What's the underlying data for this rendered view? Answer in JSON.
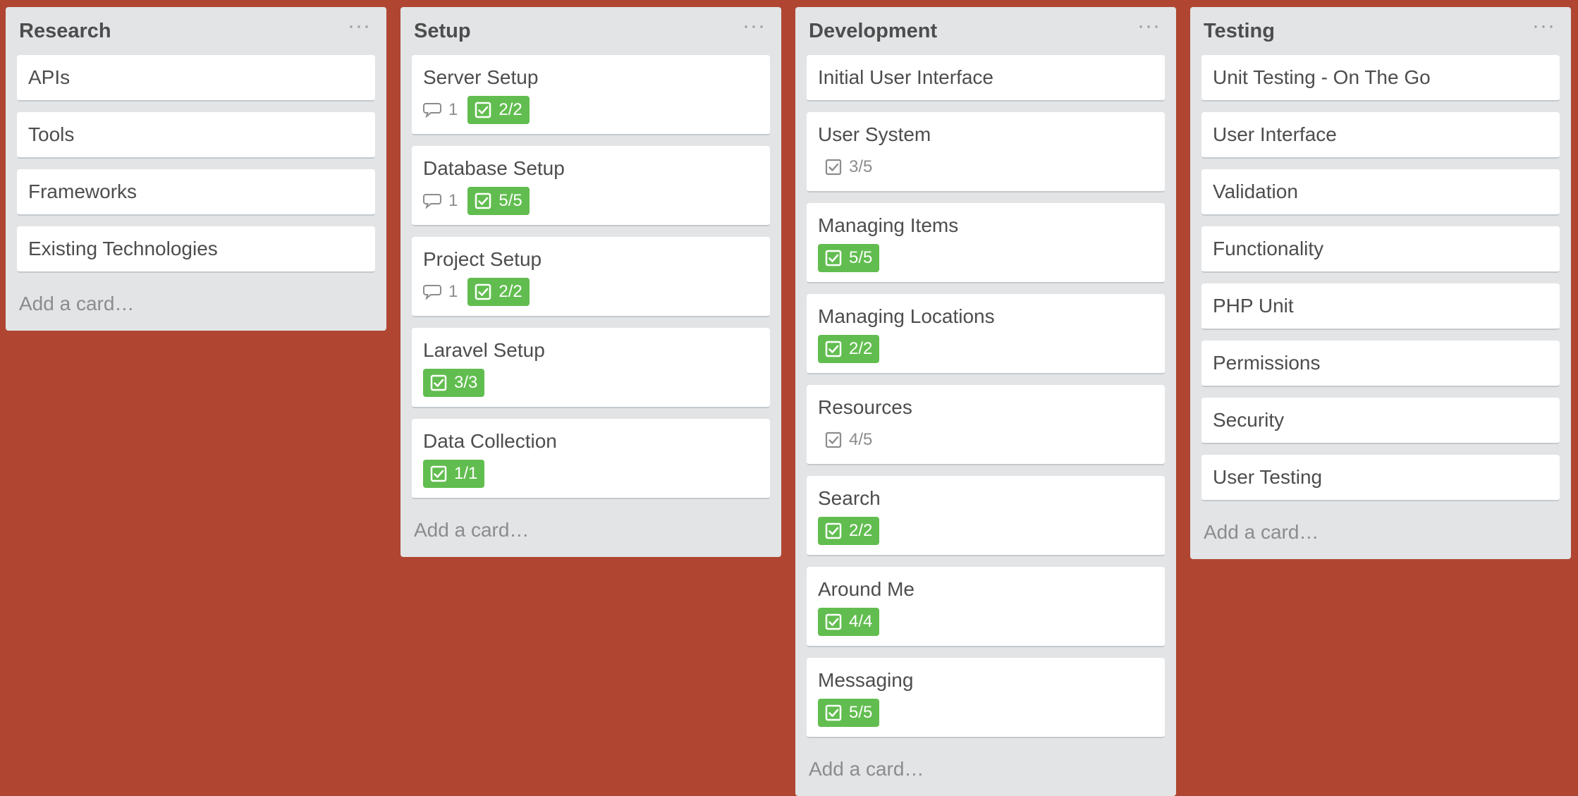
{
  "lists": [
    {
      "title": "Research",
      "menu": "···",
      "add_card": "Add a card…",
      "cards": [
        {
          "title": "APIs"
        },
        {
          "title": "Tools"
        },
        {
          "title": "Frameworks"
        },
        {
          "title": "Existing Technologies"
        }
      ]
    },
    {
      "title": "Setup",
      "menu": "···",
      "add_card": "Add a card…",
      "cards": [
        {
          "title": "Server Setup",
          "comments": "1",
          "checklist": "2/2",
          "complete": true
        },
        {
          "title": "Database Setup",
          "comments": "1",
          "checklist": "5/5",
          "complete": true
        },
        {
          "title": "Project Setup",
          "comments": "1",
          "checklist": "2/2",
          "complete": true
        },
        {
          "title": "Laravel Setup",
          "checklist": "3/3",
          "complete": true
        },
        {
          "title": "Data Collection",
          "checklist": "1/1",
          "complete": true
        }
      ]
    },
    {
      "title": "Development",
      "menu": "···",
      "add_card": "Add a card…",
      "cards": [
        {
          "title": "Initial User Interface"
        },
        {
          "title": "User System",
          "checklist": "3/5",
          "complete": false
        },
        {
          "title": "Managing Items",
          "checklist": "5/5",
          "complete": true
        },
        {
          "title": "Managing Locations",
          "checklist": "2/2",
          "complete": true
        },
        {
          "title": "Resources",
          "checklist": "4/5",
          "complete": false
        },
        {
          "title": "Search",
          "checklist": "2/2",
          "complete": true
        },
        {
          "title": "Around Me",
          "checklist": "4/4",
          "complete": true
        },
        {
          "title": "Messaging",
          "checklist": "5/5",
          "complete": true
        }
      ]
    },
    {
      "title": "Testing",
      "menu": "···",
      "add_card": "Add a card…",
      "cards": [
        {
          "title": "Unit Testing - On The Go"
        },
        {
          "title": "User Interface"
        },
        {
          "title": "Validation"
        },
        {
          "title": "Functionality"
        },
        {
          "title": "PHP Unit"
        },
        {
          "title": "Permissions"
        },
        {
          "title": "Security"
        },
        {
          "title": "User Testing"
        }
      ]
    }
  ],
  "colors": {
    "board_background": "#b04632",
    "list_background": "#e2e4e6",
    "complete_badge": "#61bd4f"
  },
  "icons": {
    "comment": "comment-icon",
    "checklist": "checklist-icon",
    "menu": "more-icon"
  }
}
